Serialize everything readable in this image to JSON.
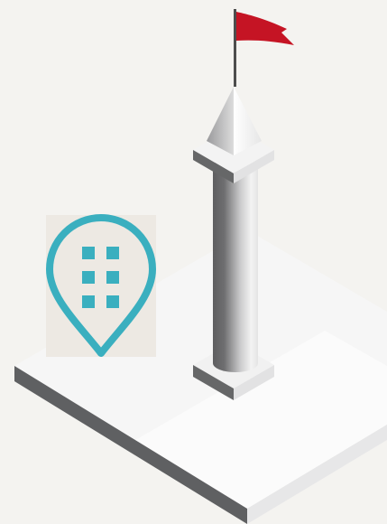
{
  "colors": {
    "background": "#f4f3f0",
    "platform_top": "#f7f7f7",
    "platform_top_light": "#ffffff",
    "platform_side_dark": "#5f6062",
    "platform_side_light": "#e9e9ea",
    "column_dark": "#6a6a6b",
    "column_light": "#f2f2f2",
    "flag": "#c51424",
    "flagpole": "#4d4d4d",
    "pin_stroke": "#3aafbf",
    "pin_fill": "#ece8e2",
    "pin_squares": "#3aafbf"
  },
  "icons": {
    "pin": "location-pin-building-icon",
    "tower": "tower-monument-icon",
    "flag": "flag-icon"
  }
}
